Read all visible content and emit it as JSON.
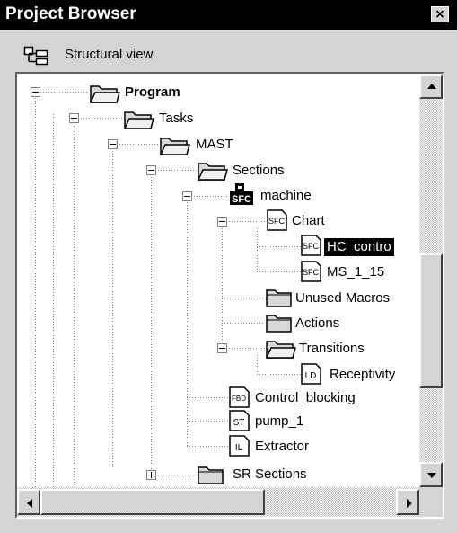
{
  "window": {
    "title": "Project Browser",
    "close_glyph": "×"
  },
  "toolbar": {
    "view_label": "Structural view",
    "view_icon": "structural-view-icon"
  },
  "tree": {
    "nodes": [
      {
        "id": "program",
        "label": "Program",
        "icon": "folder-open-icon",
        "expander": "minus",
        "bold": true
      },
      {
        "id": "tasks",
        "label": "Tasks",
        "icon": "folder-open-icon",
        "expander": "minus"
      },
      {
        "id": "mast",
        "label": "MAST",
        "icon": "folder-open-icon",
        "expander": "minus"
      },
      {
        "id": "sections",
        "label": "Sections",
        "icon": "folder-open-icon",
        "expander": "minus"
      },
      {
        "id": "machine",
        "label": "machine",
        "icon": "sfc-section-icon",
        "expander": "minus"
      },
      {
        "id": "chart",
        "label": "Chart",
        "icon": "sfc-chart-icon",
        "expander": "minus"
      },
      {
        "id": "hc_control",
        "label": "HC_contro",
        "icon": "sfc-chart-icon",
        "selected": true
      },
      {
        "id": "ms_1_15",
        "label": "MS_1_15",
        "icon": "sfc-chart-icon"
      },
      {
        "id": "unused_macros",
        "label": "Unused Macros",
        "icon": "folder-closed-icon"
      },
      {
        "id": "actions",
        "label": "Actions",
        "icon": "folder-closed-icon"
      },
      {
        "id": "transitions",
        "label": "Transitions",
        "icon": "folder-open-icon",
        "expander": "minus"
      },
      {
        "id": "receptivity",
        "label": "Receptivity",
        "icon": "ld-section-icon"
      },
      {
        "id": "control_blocking",
        "label": "Control_blocking",
        "icon": "fbd-section-icon"
      },
      {
        "id": "pump_1",
        "label": "pump_1",
        "icon": "st-section-icon"
      },
      {
        "id": "extractor",
        "label": "Extractor",
        "icon": "il-section-icon"
      },
      {
        "id": "sr_sections",
        "label": "SR Sections",
        "icon": "folder-closed-icon",
        "expander": "plus"
      }
    ],
    "icon_texts": {
      "sfc": "SFC",
      "ld": "LD",
      "fbd": "FBD",
      "st": "ST",
      "il": "IL"
    }
  },
  "scrollbars": {
    "vertical_icons": [
      "scroll-up-arrow-icon",
      "scroll-down-arrow-icon"
    ],
    "horizontal_icons": [
      "scroll-left-arrow-icon",
      "scroll-right-arrow-icon"
    ]
  }
}
